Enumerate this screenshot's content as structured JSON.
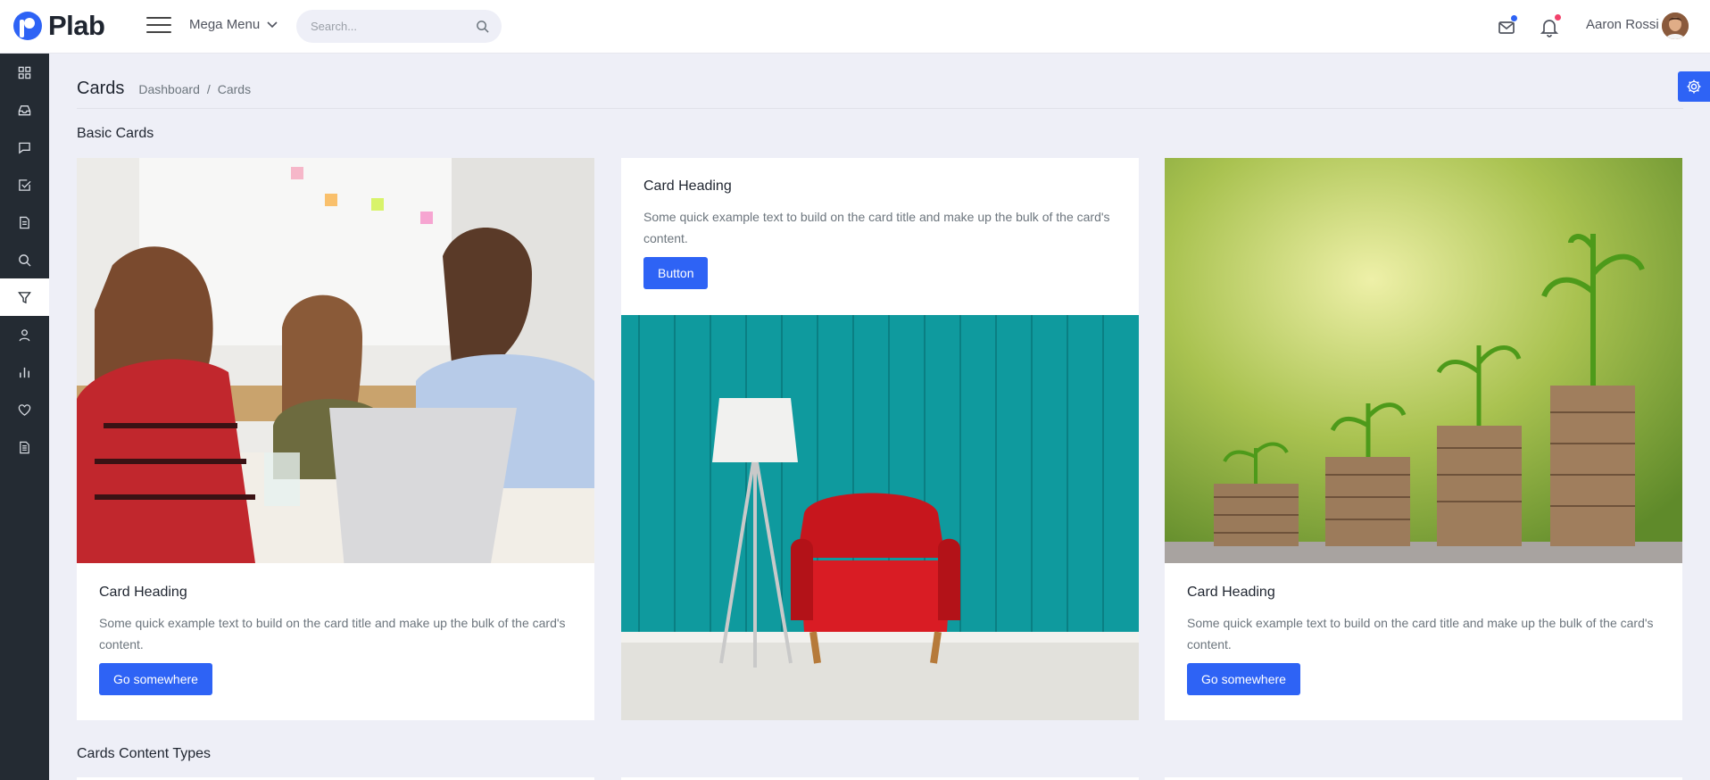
{
  "brand": {
    "name": "Plab",
    "color": "#2e63f5"
  },
  "header": {
    "mega_menu_label": "Mega Menu",
    "search_placeholder": "Search...",
    "user_name": "Aaron Rossi",
    "mail_badge_color": "#2e63f5",
    "bell_badge_color": "#f2426b"
  },
  "sidebar": {
    "items": [
      {
        "icon": "dashboard-grid-icon"
      },
      {
        "icon": "inbox-icon"
      },
      {
        "icon": "chat-icon"
      },
      {
        "icon": "check-square-icon"
      },
      {
        "icon": "document-icon"
      },
      {
        "icon": "search-icon"
      },
      {
        "icon": "filter-icon",
        "active": true
      },
      {
        "icon": "user-icon"
      },
      {
        "icon": "bar-chart-icon"
      },
      {
        "icon": "heart-icon"
      },
      {
        "icon": "file-text-icon"
      }
    ]
  },
  "page": {
    "title": "Cards",
    "breadcrumb": [
      "Dashboard",
      "/",
      "Cards"
    ]
  },
  "sections": {
    "basic": "Basic Cards",
    "content_types": "Cards Content Types"
  },
  "cards": [
    {
      "image": "team-meeting-photo",
      "heading": "Card Heading",
      "text": "Some quick example text to build on the card title and make up the bulk of the card's content.",
      "button": "Go somewhere"
    },
    {
      "image": "red-armchair-photo",
      "heading": "Card Heading",
      "text": "Some quick example text to build on the card title and make up the bulk of the card's content.",
      "button": "Button"
    },
    {
      "image": "coin-stacks-plants-photo",
      "heading": "Card Heading",
      "text": "Some quick example text to build on the card title and make up the bulk of the card's content.",
      "button": "Go somewhere"
    }
  ]
}
